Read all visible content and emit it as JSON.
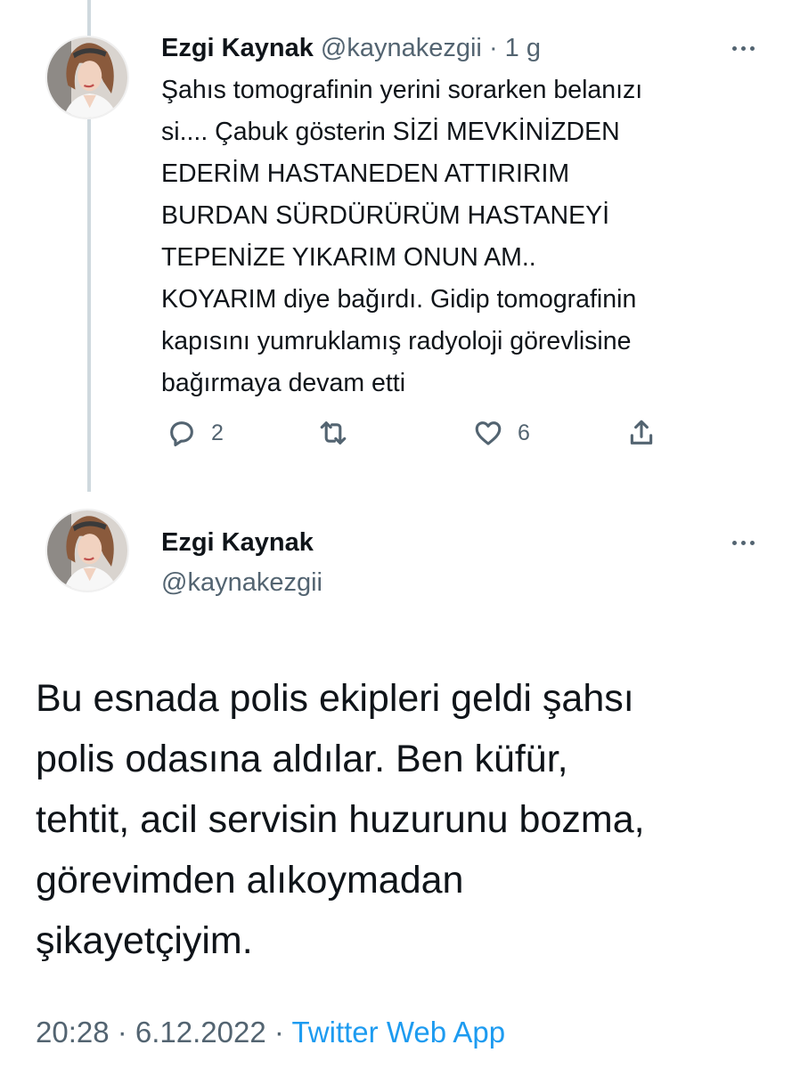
{
  "tweet1": {
    "author_name": "Ezgi Kaynak",
    "handle": "@kaynakezgii",
    "separator": "·",
    "time": "1 g",
    "body_lines": [
      "Şahıs tomografinin yerini sorarken belanızı",
      "si.... Çabuk gösterin SİZİ MEVKİNİZDEN",
      "EDERİM HASTANEDEN ATTIRIRIM",
      "BURDAN SÜRDÜRÜRÜM HASTANEYİ",
      "TEPENİZE YIKARIM ONUN AM..",
      "KOYARIM diye bağırdı. Gidip tomografinin",
      "kapısını yumruklamış radyoloji görevlisine",
      "bağırmaya devam etti"
    ],
    "actions": {
      "reply_icon": "reply-icon",
      "reply_count": "2",
      "retweet_icon": "retweet-icon",
      "retweet_count": "",
      "like_icon": "heart-icon",
      "like_count": "6",
      "share_icon": "share-icon"
    }
  },
  "tweet2": {
    "author_name": "Ezgi Kaynak",
    "handle": "@kaynakezgii",
    "body_lines": [
      "Bu esnada polis ekipleri geldi şahsı",
      "polis odasına aldılar. Ben küfür,",
      "tehtit, acil servisin huzurunu bozma,",
      "görevimden alıkoymadan",
      "şikayetçiyim."
    ],
    "timestamp": "20:28 · 6.12.2022",
    "separator": "·",
    "source": "Twitter Web App"
  },
  "colors": {
    "text_primary": "#0f1419",
    "text_secondary": "#536471",
    "link": "#1d9bf0",
    "thread_line": "#cfd9de"
  }
}
